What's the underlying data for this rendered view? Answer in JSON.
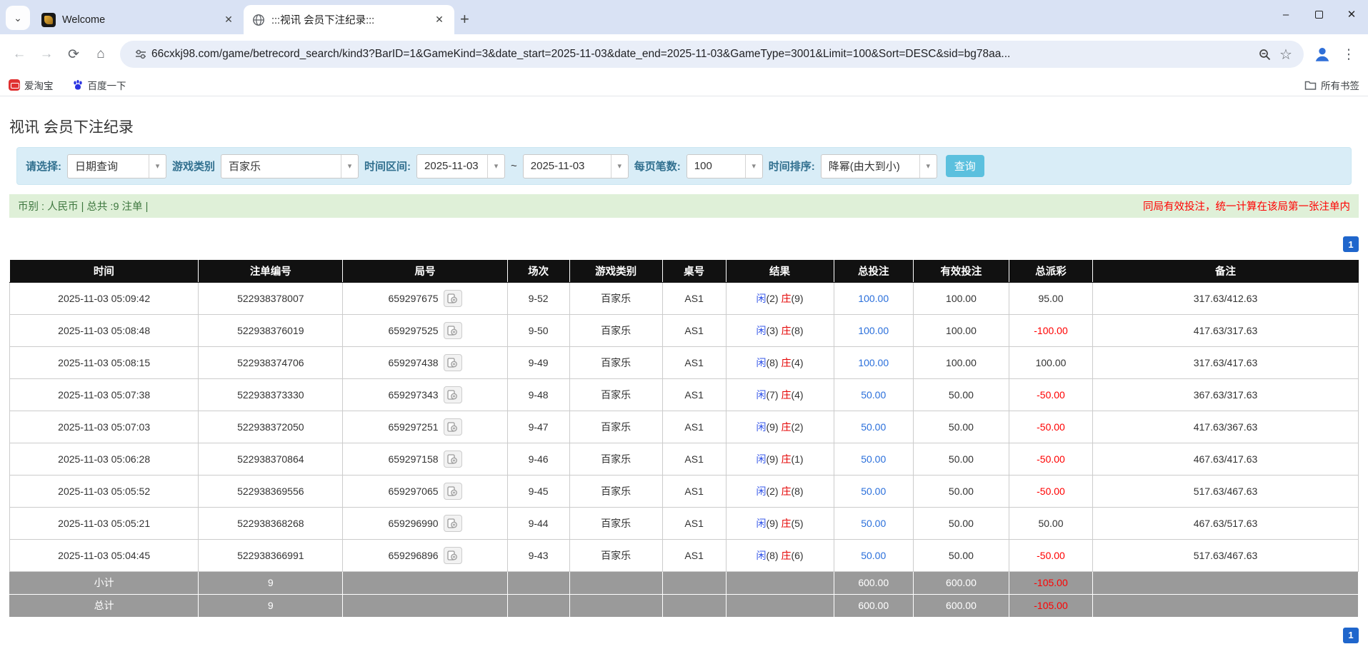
{
  "icons": {
    "tab_search": "⌄",
    "close": "✕",
    "new_tab": "+",
    "back": "←",
    "forward": "→",
    "reload": "⟳",
    "home": "⌂",
    "star": "☆",
    "menu": "⋮",
    "caret": "▾",
    "minimize": "–"
  },
  "browser": {
    "tabs": [
      {
        "title": "Welcome"
      },
      {
        "title": ":::视讯 会员下注纪录:::"
      }
    ],
    "url": "66cxkj98.com/game/betrecord_search/kind3?BarID=1&GameKind=3&date_start=2025-11-03&date_end=2025-11-03&GameType=3001&Limit=100&Sort=DESC&sid=bg78aa...",
    "bookmarks": [
      {
        "label": "爱淘宝"
      },
      {
        "label": "百度一下"
      }
    ],
    "all_bookmarks_label": "所有书签"
  },
  "page": {
    "title": "视讯 会员下注纪录",
    "filters": {
      "select_label": "请选择:",
      "select_value": "日期查询",
      "game_kind_label": "游戏类别",
      "game_kind_value": "百家乐",
      "date_range_label": "时间区间:",
      "date_start": "2025-11-03",
      "tilde": "~",
      "date_end": "2025-11-03",
      "per_page_label": "每页笔数:",
      "per_page_value": "100",
      "sort_label": "时间排序:",
      "sort_value": "降幂(由大到小)",
      "search_button": "查询"
    },
    "summary": {
      "left": "币别 : 人民币 | 总共 :9 注单 |",
      "right": "同局有效投注，统一计算在该局第一张注单内"
    },
    "pagination": "1",
    "table": {
      "headers": [
        "时间",
        "注单编号",
        "局号",
        "场次",
        "游戏类别",
        "桌号",
        "结果",
        "总投注",
        "有效投注",
        "总派彩",
        "备注"
      ],
      "rows": [
        {
          "time": "2025-11-03 05:09:42",
          "bet_id": "522938378007",
          "round_id": "659297675",
          "session": "9-52",
          "game": "百家乐",
          "table_no": "AS1",
          "player": "闲",
          "player_score": "(2)",
          "banker": "庄",
          "banker_score": "(9)",
          "total_bet": "100.00",
          "valid_bet": "100.00",
          "payout": "95.00",
          "note": "317.63/412.63"
        },
        {
          "time": "2025-11-03 05:08:48",
          "bet_id": "522938376019",
          "round_id": "659297525",
          "session": "9-50",
          "game": "百家乐",
          "table_no": "AS1",
          "player": "闲",
          "player_score": "(3)",
          "banker": "庄",
          "banker_score": "(8)",
          "total_bet": "100.00",
          "valid_bet": "100.00",
          "payout": "-100.00",
          "note": "417.63/317.63"
        },
        {
          "time": "2025-11-03 05:08:15",
          "bet_id": "522938374706",
          "round_id": "659297438",
          "session": "9-49",
          "game": "百家乐",
          "table_no": "AS1",
          "player": "闲",
          "player_score": "(8)",
          "banker": "庄",
          "banker_score": "(4)",
          "total_bet": "100.00",
          "valid_bet": "100.00",
          "payout": "100.00",
          "note": "317.63/417.63"
        },
        {
          "time": "2025-11-03 05:07:38",
          "bet_id": "522938373330",
          "round_id": "659297343",
          "session": "9-48",
          "game": "百家乐",
          "table_no": "AS1",
          "player": "闲",
          "player_score": "(7)",
          "banker": "庄",
          "banker_score": "(4)",
          "total_bet": "50.00",
          "valid_bet": "50.00",
          "payout": "-50.00",
          "note": "367.63/317.63"
        },
        {
          "time": "2025-11-03 05:07:03",
          "bet_id": "522938372050",
          "round_id": "659297251",
          "session": "9-47",
          "game": "百家乐",
          "table_no": "AS1",
          "player": "闲",
          "player_score": "(9)",
          "banker": "庄",
          "banker_score": "(2)",
          "total_bet": "50.00",
          "valid_bet": "50.00",
          "payout": "-50.00",
          "note": "417.63/367.63"
        },
        {
          "time": "2025-11-03 05:06:28",
          "bet_id": "522938370864",
          "round_id": "659297158",
          "session": "9-46",
          "game": "百家乐",
          "table_no": "AS1",
          "player": "闲",
          "player_score": "(9)",
          "banker": "庄",
          "banker_score": "(1)",
          "total_bet": "50.00",
          "valid_bet": "50.00",
          "payout": "-50.00",
          "note": "467.63/417.63"
        },
        {
          "time": "2025-11-03 05:05:52",
          "bet_id": "522938369556",
          "round_id": "659297065",
          "session": "9-45",
          "game": "百家乐",
          "table_no": "AS1",
          "player": "闲",
          "player_score": "(2)",
          "banker": "庄",
          "banker_score": "(8)",
          "total_bet": "50.00",
          "valid_bet": "50.00",
          "payout": "-50.00",
          "note": "517.63/467.63"
        },
        {
          "time": "2025-11-03 05:05:21",
          "bet_id": "522938368268",
          "round_id": "659296990",
          "session": "9-44",
          "game": "百家乐",
          "table_no": "AS1",
          "player": "闲",
          "player_score": "(9)",
          "banker": "庄",
          "banker_score": "(5)",
          "total_bet": "50.00",
          "valid_bet": "50.00",
          "payout": "50.00",
          "note": "467.63/517.63"
        },
        {
          "time": "2025-11-03 05:04:45",
          "bet_id": "522938366991",
          "round_id": "659296896",
          "session": "9-43",
          "game": "百家乐",
          "table_no": "AS1",
          "player": "闲",
          "player_score": "(8)",
          "banker": "庄",
          "banker_score": "(6)",
          "total_bet": "50.00",
          "valid_bet": "50.00",
          "payout": "-50.00",
          "note": "517.63/467.63"
        }
      ],
      "footer": [
        {
          "label": "小计",
          "count": "9",
          "total_bet": "600.00",
          "valid_bet": "600.00",
          "payout": "-105.00"
        },
        {
          "label": "总计",
          "count": "9",
          "total_bet": "600.00",
          "valid_bet": "600.00",
          "payout": "-105.00"
        }
      ]
    }
  }
}
